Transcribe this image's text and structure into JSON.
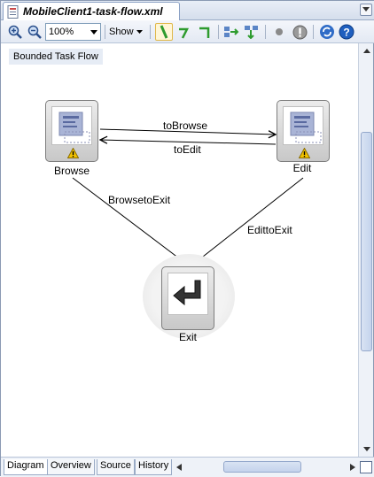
{
  "document_tab": {
    "title": "MobileClient1-task-flow.xml"
  },
  "toolbar": {
    "zoom_value": "100%",
    "show_label": "Show"
  },
  "canvas": {
    "flow_label": "Bounded Task Flow",
    "nodes": {
      "browse": "Browse",
      "edit": "Edit",
      "exit": "Exit"
    },
    "edges": {
      "to_browse": "toBrowse",
      "to_edit": "toEdit",
      "browse_to_exit": "BrowsetoExit",
      "edit_to_exit": "EdittoExit"
    }
  },
  "bottom_tabs": [
    "Diagram",
    "Overview",
    "Source",
    "History"
  ],
  "active_bottom_tab": "Diagram",
  "colors": {
    "warning": "#f2c200",
    "toolbar_green": "#2e9b2e",
    "help_blue": "#1f5fbf"
  }
}
